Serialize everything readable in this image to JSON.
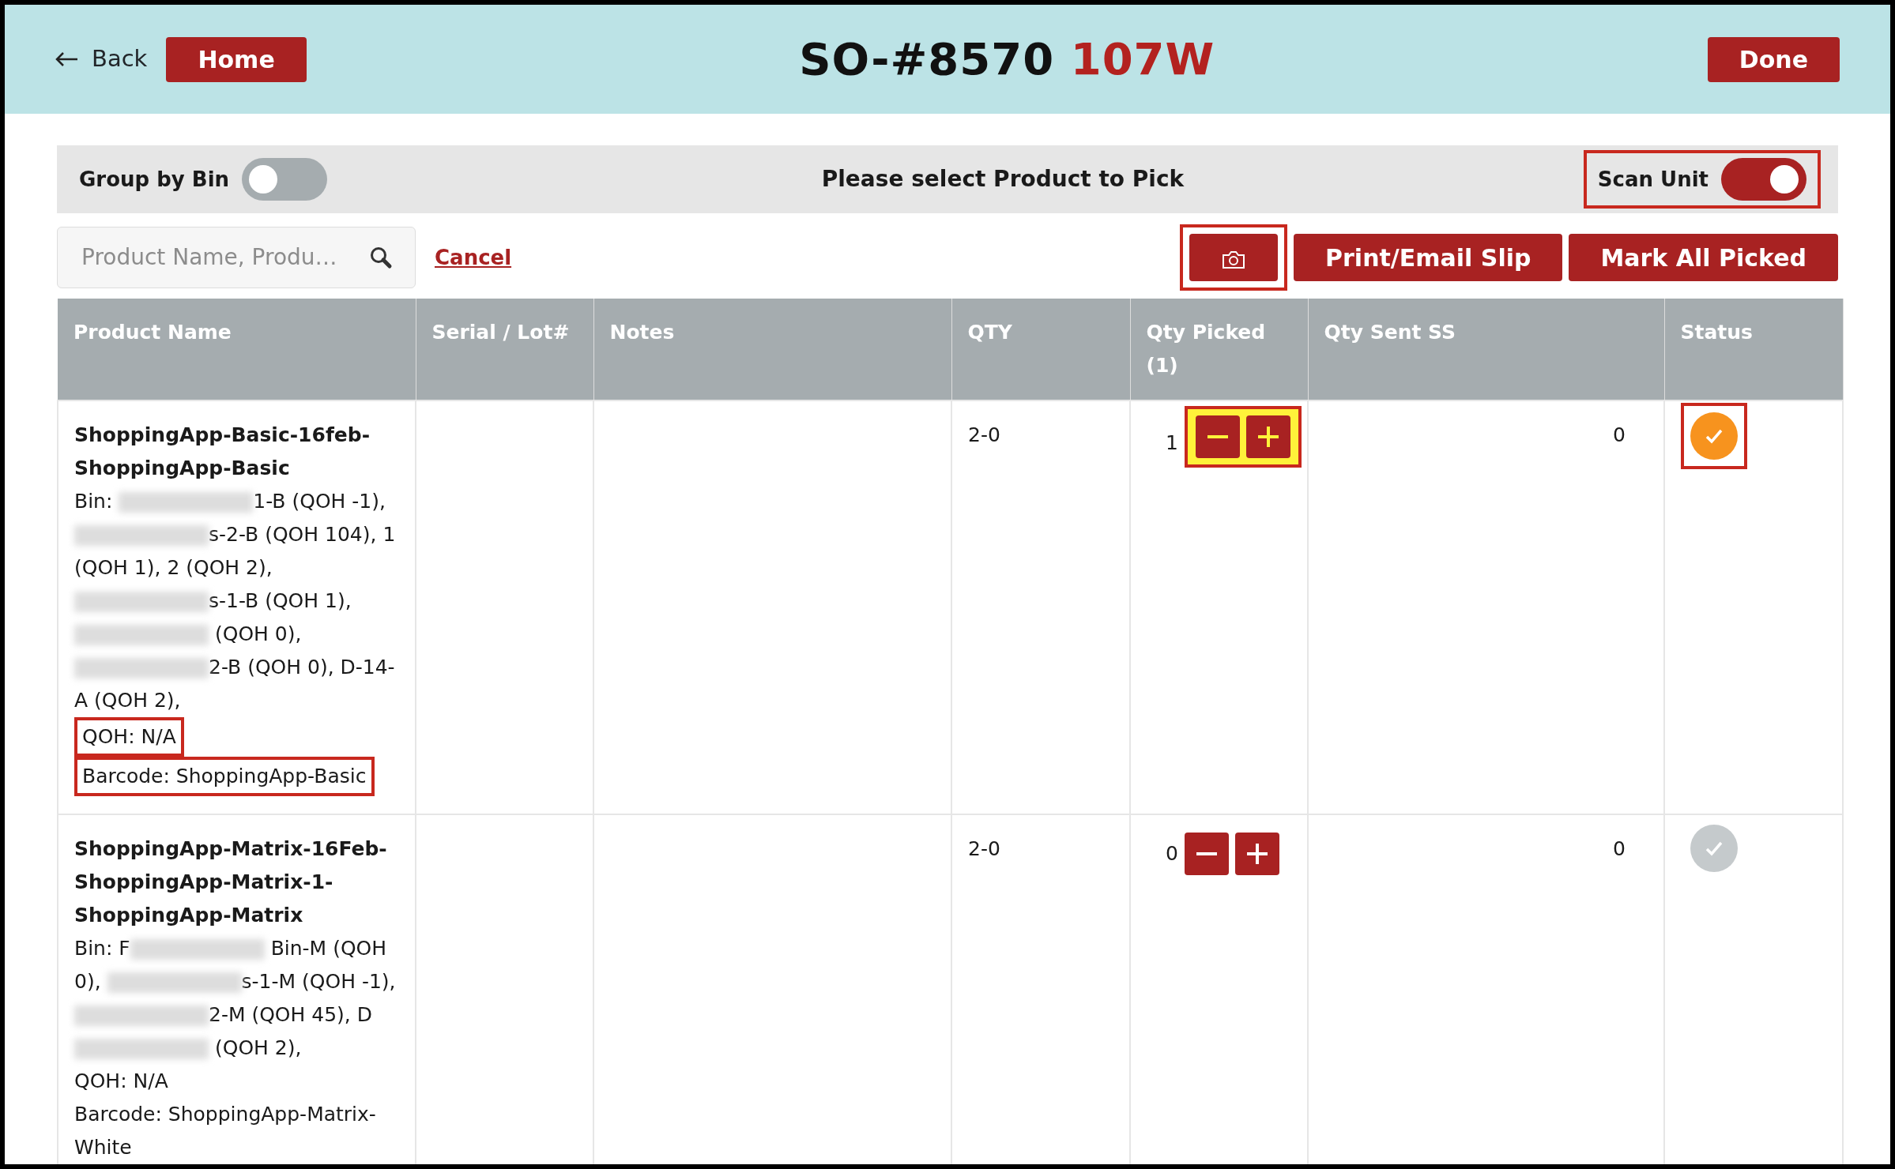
{
  "header": {
    "back_label": "Back",
    "home_label": "Home",
    "title": "SO-#8570",
    "title_suffix": "107W",
    "done_label": "Done"
  },
  "toolbar": {
    "group_by_bin": {
      "label": "Group by Bin",
      "on": false,
      "annotated": false
    },
    "message": "Please select Product to Pick",
    "scan_unit": {
      "label": "Scan Unit",
      "on": true,
      "annotated": true
    }
  },
  "search": {
    "placeholder": "Product Name, Produ…",
    "cancel_label": "Cancel"
  },
  "actions": [
    {
      "kind": "camera",
      "annotated": true
    },
    {
      "kind": "text",
      "label": "Print/Email Slip",
      "annotated": false
    },
    {
      "kind": "text",
      "label": "Mark All Picked",
      "annotated": false
    }
  ],
  "table": {
    "columns": [
      "Product Name",
      "Serial / Lot#",
      "Notes",
      "QTY",
      "Qty Picked (1)",
      "Qty Sent SS",
      "Status"
    ],
    "rows": [
      {
        "name": "ShoppingApp-Basic-16feb-ShoppingApp-Basic",
        "bin_parts": [
          {
            "kind": "text",
            "text": "Bin: "
          },
          {
            "kind": "redacted"
          },
          {
            "kind": "text",
            "text": "1-B (QOH -1), "
          },
          {
            "kind": "redacted"
          },
          {
            "kind": "text",
            "text": "s-2-B (QOH 104), 1 (QOH 1), 2 (QOH 2), "
          },
          {
            "kind": "redacted"
          },
          {
            "kind": "text",
            "text": "s-1-B (QOH 1), "
          },
          {
            "kind": "redacted"
          },
          {
            "kind": "text",
            "text": " (QOH 0), "
          },
          {
            "kind": "redacted"
          },
          {
            "kind": "text",
            "text": "2-B (QOH 0), D-14-A (QOH 2),"
          }
        ],
        "qoh": "QOH: N/A",
        "qoh_annotated": true,
        "barcode": "Barcode: ShoppingApp-Basic",
        "barcode_annotated": true,
        "qty": "2-0",
        "qty_picked": "1",
        "stepper_highlighted": true,
        "qty_sent": "0",
        "picked": true,
        "status_annotated": true
      },
      {
        "name": "ShoppingApp-Matrix-16Feb-ShoppingApp-Matrix-1-ShoppingApp-Matrix",
        "bin_parts": [
          {
            "kind": "text",
            "text": "Bin: F"
          },
          {
            "kind": "redacted"
          },
          {
            "kind": "text",
            "text": " Bin-M (QOH 0), "
          },
          {
            "kind": "redacted"
          },
          {
            "kind": "text",
            "text": "s-1-M (QOH -1), "
          },
          {
            "kind": "redacted"
          },
          {
            "kind": "text",
            "text": "2-M (QOH 45), D"
          },
          {
            "kind": "redacted"
          },
          {
            "kind": "text",
            "text": " (QOH 2),"
          }
        ],
        "qoh": "QOH: N/A",
        "qoh_annotated": false,
        "barcode": "Barcode: ShoppingApp-Matrix-White",
        "barcode_annotated": false,
        "qty": "2-0",
        "qty_picked": "0",
        "stepper_highlighted": false,
        "qty_sent": "0",
        "picked": false,
        "status_annotated": false
      }
    ]
  }
}
